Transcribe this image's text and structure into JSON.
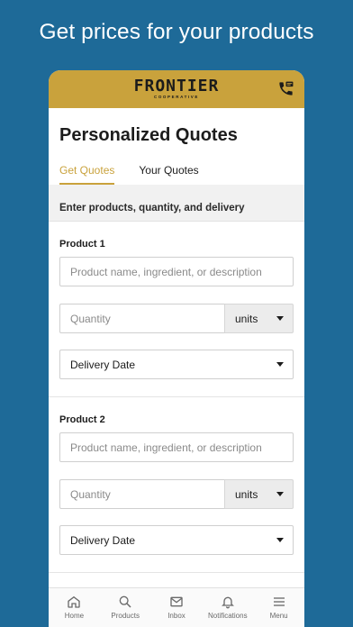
{
  "promo": {
    "headline": "Get prices for your products"
  },
  "header": {
    "logo_main": "FRONTIER",
    "logo_sub": "COOPERATIVE"
  },
  "page": {
    "title": "Personalized Quotes",
    "tabs": [
      {
        "label": "Get Quotes",
        "active": true
      },
      {
        "label": "Your Quotes",
        "active": false
      }
    ],
    "banner": "Enter products, quantity, and delivery"
  },
  "products": [
    {
      "label": "Product 1",
      "name_placeholder": "Product name, ingredient, or description",
      "quantity_placeholder": "Quantity",
      "units_value": "units",
      "delivery_value": "Delivery Date"
    },
    {
      "label": "Product 2",
      "name_placeholder": "Product name, ingredient, or description",
      "quantity_placeholder": "Quantity",
      "units_value": "units",
      "delivery_value": "Delivery Date"
    }
  ],
  "tabbar": [
    {
      "label": "Home",
      "icon": "home-icon"
    },
    {
      "label": "Products",
      "icon": "search-icon"
    },
    {
      "label": "Inbox",
      "icon": "mail-icon"
    },
    {
      "label": "Notifications",
      "icon": "bell-icon"
    },
    {
      "label": "Menu",
      "icon": "menu-icon"
    }
  ],
  "colors": {
    "background": "#1e6a98",
    "brand_gold": "#c9a23c"
  }
}
